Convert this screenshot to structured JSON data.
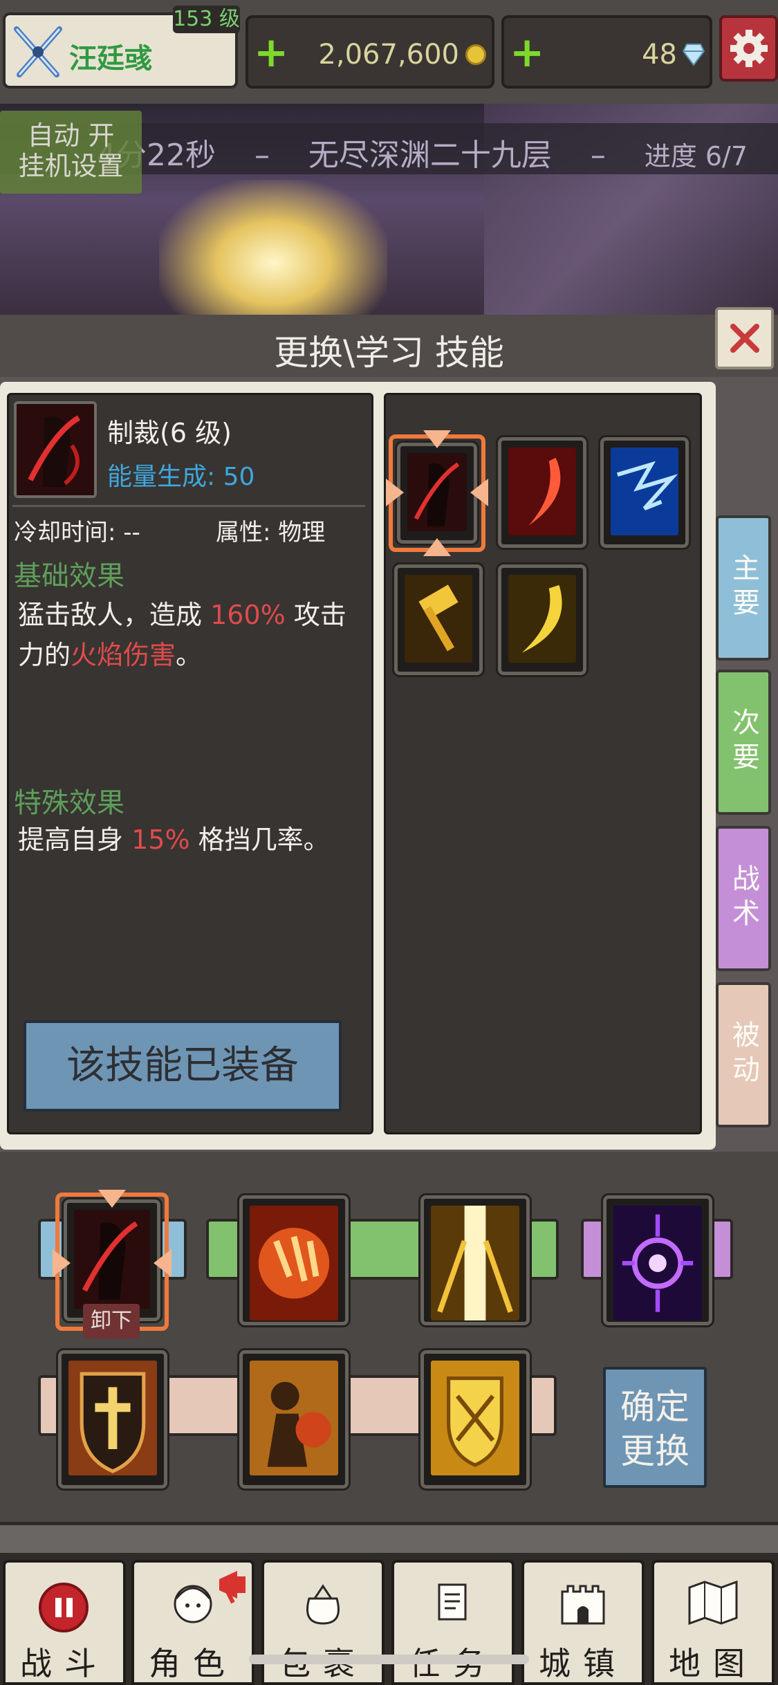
{
  "player": {
    "name": "汪廷彧",
    "level": "153 级",
    "icon": "crossed-swords-icon"
  },
  "resources": {
    "gold": "2,067,600",
    "gold_icon": "gold-coin-icon",
    "gems": "48",
    "gem_icon": "diamond-icon",
    "plus_symbol": "+"
  },
  "stage": {
    "timer": "4分22秒",
    "separator": "–",
    "name": "无尽深渊二十九层",
    "progress": "进度 6/7",
    "auto_label_line1": "自动 开",
    "auto_label_line2": "挂机设置"
  },
  "panel": {
    "title": "更换\\学习 技能",
    "close_icon": "close-x-icon"
  },
  "skill_detail": {
    "name": "制裁(6 级)",
    "energy": "能量生成: 50",
    "cooldown": "冷却时间: --",
    "attribute": "属性: 物理",
    "basic_title": "基础效果",
    "basic_text_1": "猛击敌人，造成",
    "basic_pct": "160%",
    "basic_text_2": "攻击",
    "basic_text_3": "力的",
    "basic_fire": "火焰伤害",
    "basic_text_4": "。",
    "special_title": "特殊效果",
    "special_text_1": "提高自身",
    "special_pct": "15%",
    "special_text_2": "格挡几率。",
    "equipped_label": "该技能已装备"
  },
  "skill_list": [
    {
      "icon": "red-warrior-slash-icon",
      "selected": true
    },
    {
      "icon": "red-crescent-icon",
      "selected": false
    },
    {
      "icon": "blue-lightning-claw-icon",
      "selected": false
    },
    {
      "icon": "golden-hammer-icon",
      "selected": false
    },
    {
      "icon": "golden-crescent-icon",
      "selected": false
    }
  ],
  "tabs": [
    {
      "label": "主要",
      "color": "#8fbfd8"
    },
    {
      "label": "次要",
      "color": "#82c26e"
    },
    {
      "label": "战术",
      "color": "#c58fd8"
    },
    {
      "label": "被动",
      "color": "#e5c8b7"
    }
  ],
  "equipped": {
    "row1": [
      {
        "icon": "red-warrior-slash-icon",
        "track_color": "#8fbfd8"
      },
      {
        "icon": "fire-claw-icon",
        "track_color": "#82c26e"
      },
      {
        "icon": "golden-light-pillar-icon",
        "track_color": "#82c26e"
      },
      {
        "icon": "purple-vortex-icon",
        "track_color": "#c58fd8"
      }
    ],
    "row2": [
      {
        "icon": "holy-cross-shield-icon"
      },
      {
        "icon": "golden-warrior-icon"
      },
      {
        "icon": "golden-emblem-shield-icon"
      }
    ],
    "unequip_label": "卸下",
    "confirm_line1": "确定",
    "confirm_line2": "更换"
  },
  "nav": [
    {
      "label": "战斗",
      "icon": "pause-icon"
    },
    {
      "label": "角色",
      "icon": "character-face-icon"
    },
    {
      "label": "包裹",
      "icon": "bag-icon"
    },
    {
      "label": "任务",
      "icon": "quest-scroll-icon"
    },
    {
      "label": "城镇",
      "icon": "castle-icon"
    },
    {
      "label": "地图",
      "icon": "map-icon"
    }
  ]
}
